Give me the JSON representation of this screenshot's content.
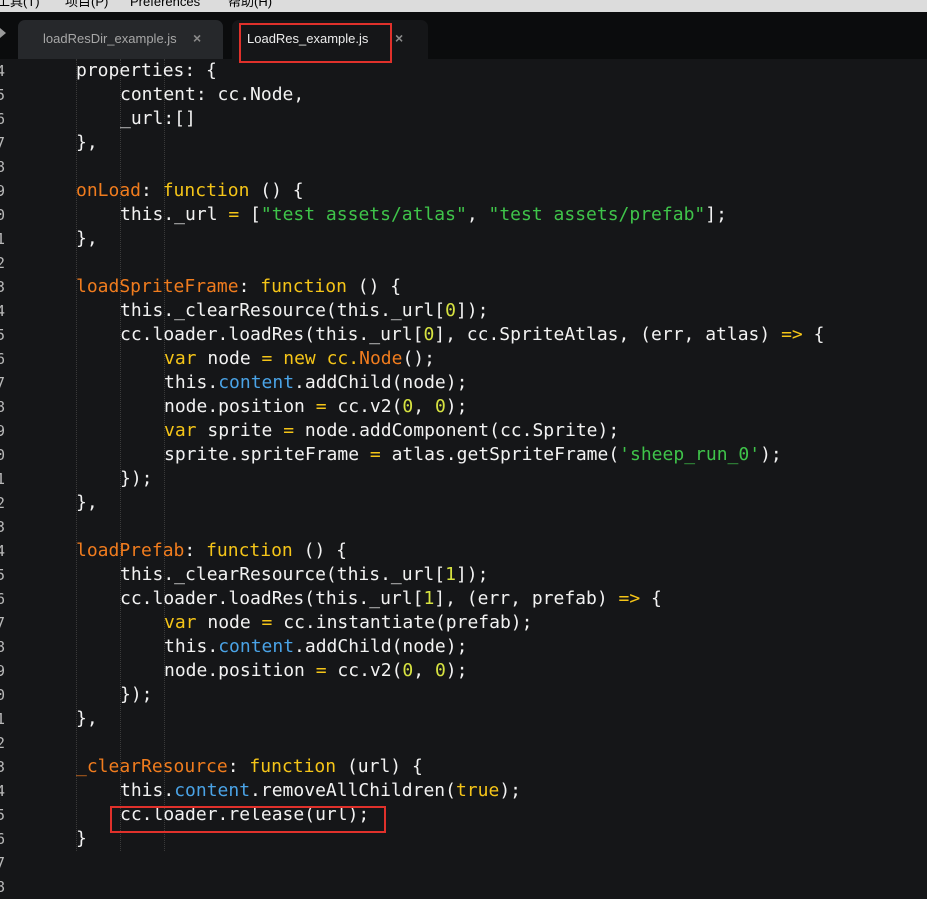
{
  "menu": [
    {
      "label": "工具(T)"
    },
    {
      "label": "项目(P)"
    },
    {
      "label": "Preferences"
    },
    {
      "label": "帮助(H)"
    }
  ],
  "tabs": [
    {
      "label": "loadResDir_example.js",
      "close": "×",
      "active": false
    },
    {
      "label": "LoadRes_example.js",
      "close": "×",
      "active": true
    }
  ],
  "colors": {
    "keyword": "#f5c518",
    "function_name": "#f07c1e",
    "string": "#3fc44a",
    "number": "#d7e341",
    "property": "#4aa3e6",
    "highlight": "#e0312b"
  },
  "editor": {
    "line_numbers": [
      "4",
      "5",
      "6",
      "7",
      "8",
      "9",
      "0",
      "1",
      "2",
      "3",
      "4",
      "5",
      "6",
      "7",
      "8",
      "9",
      "0",
      "1",
      "2",
      "3",
      "4",
      "5",
      "6",
      "7",
      "8",
      "9",
      "0",
      "1",
      "2",
      "3",
      "4",
      "5",
      "6",
      "7",
      "8"
    ],
    "lines": [
      {
        "indent": 2,
        "tokens": [
          {
            "t": "t",
            "v": "properties: {"
          }
        ]
      },
      {
        "indent": 3,
        "tokens": [
          {
            "t": "t",
            "v": "content: cc.Node,"
          }
        ]
      },
      {
        "indent": 3,
        "tokens": [
          {
            "t": "t",
            "v": "_url:[]"
          }
        ]
      },
      {
        "indent": 2,
        "tokens": [
          {
            "t": "t",
            "v": "},"
          }
        ]
      },
      {
        "indent": 0,
        "tokens": []
      },
      {
        "indent": 2,
        "tokens": [
          {
            "t": "f",
            "v": "onLoad"
          },
          {
            "t": "t",
            "v": ": "
          },
          {
            "t": "k",
            "v": "function"
          },
          {
            "t": "t",
            "v": " () {"
          }
        ]
      },
      {
        "indent": 3,
        "tokens": [
          {
            "t": "t",
            "v": "this._url "
          },
          {
            "t": "k",
            "v": "="
          },
          {
            "t": "t",
            "v": " ["
          },
          {
            "t": "s",
            "v": "\"test assets/atlas\""
          },
          {
            "t": "t",
            "v": ", "
          },
          {
            "t": "s",
            "v": "\"test assets/prefab\""
          },
          {
            "t": "t",
            "v": "];"
          }
        ]
      },
      {
        "indent": 2,
        "tokens": [
          {
            "t": "t",
            "v": "},"
          }
        ]
      },
      {
        "indent": 0,
        "tokens": []
      },
      {
        "indent": 2,
        "tokens": [
          {
            "t": "f",
            "v": "loadSpriteFrame"
          },
          {
            "t": "t",
            "v": ": "
          },
          {
            "t": "k",
            "v": "function"
          },
          {
            "t": "t",
            "v": " () {"
          }
        ]
      },
      {
        "indent": 3,
        "tokens": [
          {
            "t": "t",
            "v": "this._clearResource(this._url["
          },
          {
            "t": "n",
            "v": "0"
          },
          {
            "t": "t",
            "v": "]);"
          }
        ]
      },
      {
        "indent": 3,
        "tokens": [
          {
            "t": "t",
            "v": "cc.loader.loadRes(this._url["
          },
          {
            "t": "n",
            "v": "0"
          },
          {
            "t": "t",
            "v": "], cc.SpriteAtlas, (err, atlas) "
          },
          {
            "t": "k",
            "v": "=>"
          },
          {
            "t": "t",
            "v": " {"
          }
        ]
      },
      {
        "indent": 4,
        "tokens": [
          {
            "t": "k",
            "v": "var"
          },
          {
            "t": "t",
            "v": " node "
          },
          {
            "t": "k",
            "v": "="
          },
          {
            "t": "t",
            "v": " "
          },
          {
            "t": "k",
            "v": "new"
          },
          {
            "t": "t",
            "v": " "
          },
          {
            "t": "k",
            "v": "cc."
          },
          {
            "t": "f",
            "v": "Node"
          },
          {
            "t": "t",
            "v": "();"
          }
        ]
      },
      {
        "indent": 4,
        "tokens": [
          {
            "t": "t",
            "v": "this."
          },
          {
            "t": "p",
            "v": "content"
          },
          {
            "t": "t",
            "v": ".addChild(node);"
          }
        ]
      },
      {
        "indent": 4,
        "tokens": [
          {
            "t": "t",
            "v": "node.position "
          },
          {
            "t": "k",
            "v": "="
          },
          {
            "t": "t",
            "v": " cc.v2("
          },
          {
            "t": "n",
            "v": "0"
          },
          {
            "t": "t",
            "v": ", "
          },
          {
            "t": "n",
            "v": "0"
          },
          {
            "t": "t",
            "v": ");"
          }
        ]
      },
      {
        "indent": 4,
        "tokens": [
          {
            "t": "k",
            "v": "var"
          },
          {
            "t": "t",
            "v": " sprite "
          },
          {
            "t": "k",
            "v": "="
          },
          {
            "t": "t",
            "v": " node.addComponent(cc.Sprite);"
          }
        ]
      },
      {
        "indent": 4,
        "tokens": [
          {
            "t": "t",
            "v": "sprite.spriteFrame "
          },
          {
            "t": "k",
            "v": "="
          },
          {
            "t": "t",
            "v": " atlas.getSpriteFrame("
          },
          {
            "t": "s",
            "v": "'sheep_run_0'"
          },
          {
            "t": "t",
            "v": ");"
          }
        ]
      },
      {
        "indent": 3,
        "tokens": [
          {
            "t": "t",
            "v": "});"
          }
        ]
      },
      {
        "indent": 2,
        "tokens": [
          {
            "t": "t",
            "v": "},"
          }
        ]
      },
      {
        "indent": 0,
        "tokens": []
      },
      {
        "indent": 2,
        "tokens": [
          {
            "t": "f",
            "v": "loadPrefab"
          },
          {
            "t": "t",
            "v": ": "
          },
          {
            "t": "k",
            "v": "function"
          },
          {
            "t": "t",
            "v": " () {"
          }
        ]
      },
      {
        "indent": 3,
        "tokens": [
          {
            "t": "t",
            "v": "this._clearResource(this._url["
          },
          {
            "t": "n",
            "v": "1"
          },
          {
            "t": "t",
            "v": "]);"
          }
        ]
      },
      {
        "indent": 3,
        "tokens": [
          {
            "t": "t",
            "v": "cc.loader.loadRes(this._url["
          },
          {
            "t": "n",
            "v": "1"
          },
          {
            "t": "t",
            "v": "], (err, prefab) "
          },
          {
            "t": "k",
            "v": "=>"
          },
          {
            "t": "t",
            "v": " {"
          }
        ]
      },
      {
        "indent": 4,
        "tokens": [
          {
            "t": "k",
            "v": "var"
          },
          {
            "t": "t",
            "v": " node "
          },
          {
            "t": "k",
            "v": "="
          },
          {
            "t": "t",
            "v": " cc.instantiate(prefab);"
          }
        ]
      },
      {
        "indent": 4,
        "tokens": [
          {
            "t": "t",
            "v": "this."
          },
          {
            "t": "p",
            "v": "content"
          },
          {
            "t": "t",
            "v": ".addChild(node);"
          }
        ]
      },
      {
        "indent": 4,
        "tokens": [
          {
            "t": "t",
            "v": "node.position "
          },
          {
            "t": "k",
            "v": "="
          },
          {
            "t": "t",
            "v": " cc.v2("
          },
          {
            "t": "n",
            "v": "0"
          },
          {
            "t": "t",
            "v": ", "
          },
          {
            "t": "n",
            "v": "0"
          },
          {
            "t": "t",
            "v": ");"
          }
        ]
      },
      {
        "indent": 3,
        "tokens": [
          {
            "t": "t",
            "v": "});"
          }
        ]
      },
      {
        "indent": 2,
        "tokens": [
          {
            "t": "t",
            "v": "},"
          }
        ]
      },
      {
        "indent": 0,
        "tokens": []
      },
      {
        "indent": 2,
        "tokens": [
          {
            "t": "f",
            "v": "_clearResource"
          },
          {
            "t": "t",
            "v": ": "
          },
          {
            "t": "k",
            "v": "function"
          },
          {
            "t": "t",
            "v": " (url) {"
          }
        ]
      },
      {
        "indent": 3,
        "tokens": [
          {
            "t": "t",
            "v": "this."
          },
          {
            "t": "p",
            "v": "content"
          },
          {
            "t": "t",
            "v": ".removeAllChildren("
          },
          {
            "t": "k",
            "v": "true"
          },
          {
            "t": "t",
            "v": ");"
          }
        ]
      },
      {
        "indent": 3,
        "tokens": [
          {
            "t": "t",
            "v": "cc.loader.release(url);"
          }
        ]
      },
      {
        "indent": 2,
        "tokens": [
          {
            "t": "t",
            "v": "}"
          }
        ]
      }
    ]
  }
}
